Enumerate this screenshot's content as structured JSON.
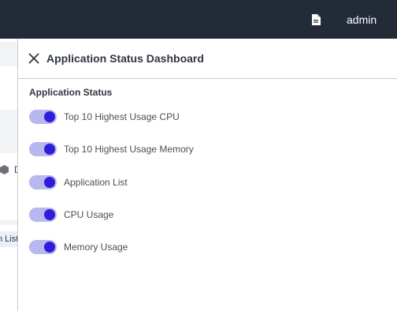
{
  "topbar": {
    "user_name": "admin",
    "doc_icon": "document-icon"
  },
  "background": {
    "partial_char": "D",
    "partial_pill": "n List"
  },
  "drawer": {
    "title": "Application Status Dashboard",
    "close_icon": "close-icon",
    "section_title": "Application Status",
    "toggles": [
      {
        "label": "Top 10 Highest Usage CPU",
        "on": true
      },
      {
        "label": "Top 10 Highest Usage Memory",
        "on": true
      },
      {
        "label": "Application List",
        "on": true
      },
      {
        "label": "CPU Usage",
        "on": true
      },
      {
        "label": "Memory Usage",
        "on": true
      }
    ]
  },
  "colors": {
    "topbar": "#232b39",
    "toggle_track": "#b9b6f0",
    "toggle_knob": "#2d1fd9"
  }
}
